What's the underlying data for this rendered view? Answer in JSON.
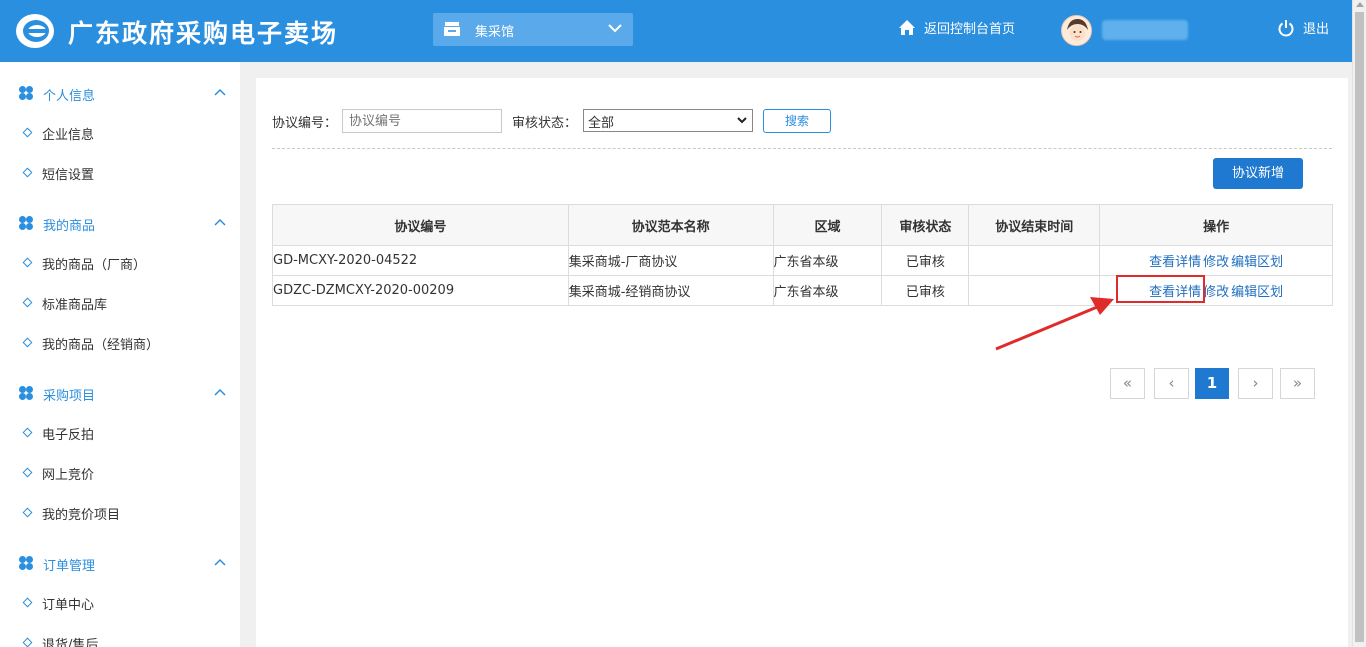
{
  "header": {
    "site_title": "广东政府采购电子卖场",
    "hall_select": "集采馆",
    "home_label": "返回控制台首页",
    "logout_label": "退出"
  },
  "sidebar": {
    "sections": [
      {
        "label": "个人信息",
        "items": [
          "企业信息",
          "短信设置"
        ]
      },
      {
        "label": "我的商品",
        "items": [
          "我的商品（厂商）",
          "标准商品库",
          "我的商品（经销商）"
        ]
      },
      {
        "label": "采购项目",
        "items": [
          "电子反拍",
          "网上竞价",
          "我的竞价项目"
        ]
      },
      {
        "label": "订单管理",
        "items": [
          "订单中心",
          "退货/售后"
        ]
      }
    ]
  },
  "filters": {
    "agreement_no_label": "协议编号：",
    "agreement_no_placeholder": "协议编号",
    "review_status_label": "审核状态：",
    "review_status_value": "全部",
    "search_label": "搜索",
    "add_label": "协议新增"
  },
  "table": {
    "headers": [
      "协议编号",
      "协议范本名称",
      "区域",
      "审核状态",
      "协议结束时间",
      "操作"
    ],
    "rows": [
      {
        "no": "GD-MCXY-2020-04522",
        "template": "集采商城-厂商协议",
        "region": "广东省本级",
        "status": "已审核",
        "end_time": "",
        "ops": [
          "查看详情",
          "修改",
          "编辑区划"
        ]
      },
      {
        "no": "GDZC-DZMCXY-2020-00209",
        "template": "集采商城-经销商协议",
        "region": "广东省本级",
        "status": "已审核",
        "end_time": "",
        "ops": [
          "查看详情",
          "修改",
          "编辑区划"
        ]
      }
    ]
  },
  "pagination": {
    "first": "«",
    "prev": "‹",
    "current": "1",
    "next": "›",
    "last": "»"
  },
  "colors": {
    "header_bg": "#2b8fdf",
    "primary_button": "#1f79d1",
    "link": "#1f6fc1",
    "highlight": "#e02b2b"
  }
}
